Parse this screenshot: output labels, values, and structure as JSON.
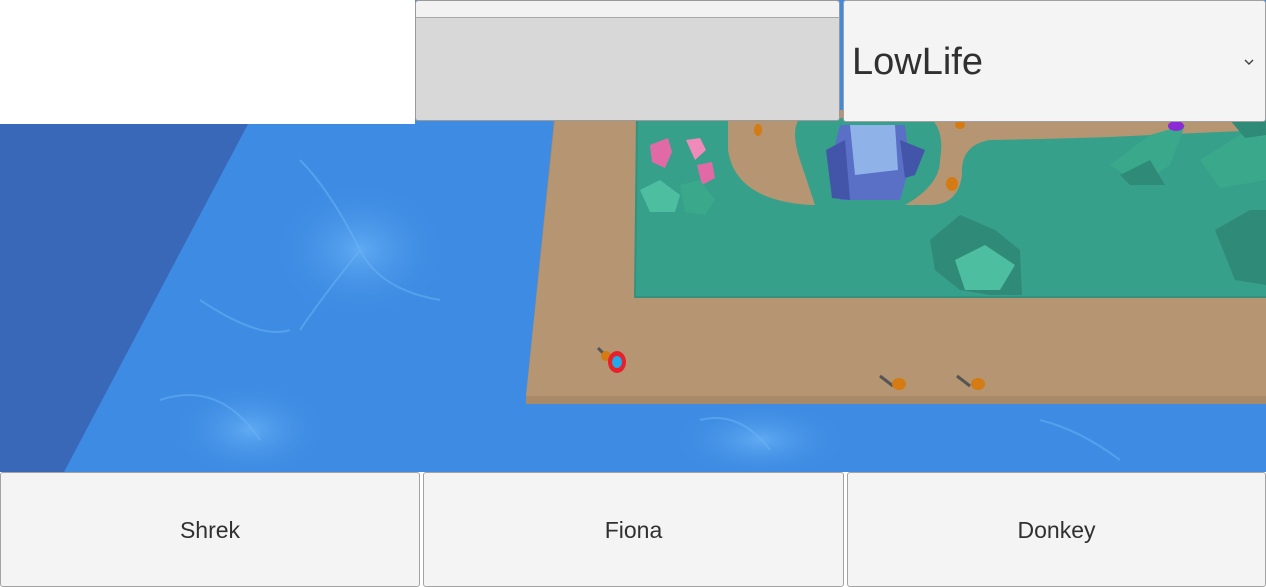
{
  "hud": {
    "progress_value": 0,
    "dropdown_selected": "LowLife"
  },
  "characters": [
    {
      "label": "Shrek"
    },
    {
      "label": "Fiona"
    },
    {
      "label": "Donkey"
    }
  ],
  "colors": {
    "water_light": "#3d8be3",
    "water_dark": "#3a68b8",
    "path_sand": "#b59572",
    "grass": "#36a08a",
    "tree_dark": "#2f8a78",
    "tree_light": "#4dbfa0",
    "crystal_pink": "#e16aa6",
    "tower_blue": "#5a6fc6",
    "unit_orange": "#d47b14",
    "player_marker_ring": "#e8202a",
    "player_marker_core": "#23a9e8",
    "button_bg": "#f4f4f4",
    "progress_bg": "#d8d8d8"
  },
  "icons": {
    "dropdown": "chevron-down-icon"
  }
}
